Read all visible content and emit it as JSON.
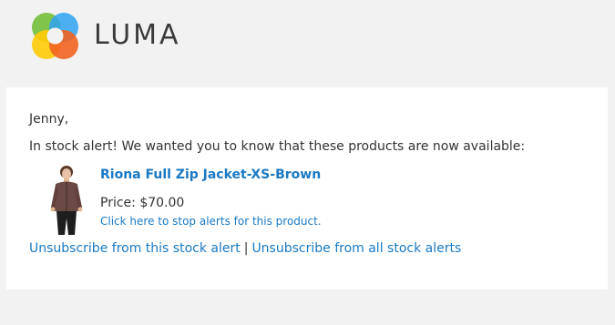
{
  "header": {
    "brand": "LUMA",
    "logo_icon": "luma-logo-icon",
    "colors": {
      "orange": "#f26322",
      "yellow": "#ffcb05",
      "green": "#7ac142",
      "blue": "#2ea3f2",
      "text": "#3b3b3b"
    }
  },
  "email": {
    "greeting": "Jenny,",
    "intro": "In stock alert! We wanted you to know that these products are now available:",
    "product": {
      "name": "Riona Full Zip Jacket-XS-Brown",
      "price": "Price: $70.00",
      "stop_alert": "Click here to stop alerts for this product.",
      "image_icon": "product-image"
    },
    "unsubscribe_one": "Unsubscribe from this stock alert",
    "separator": "|",
    "unsubscribe_all": "Unsubscribe from all stock alerts"
  },
  "colors": {
    "link": "#1979c3",
    "text": "#333333",
    "background": "#f2f2f2",
    "card": "#ffffff"
  }
}
